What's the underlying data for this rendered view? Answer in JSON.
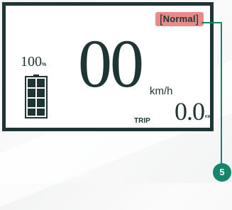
{
  "display": {
    "mode": "Normal",
    "mode_bracket_open": "[",
    "mode_bracket_close": "]",
    "battery_percent": "100",
    "battery_percent_unit": "%",
    "battery_level": 1.0,
    "speed": "00",
    "speed_unit": "km/h",
    "trip_label": "TRIP",
    "trip_value": "0.0",
    "trip_unit": "KM"
  },
  "callout": {
    "number": "5"
  },
  "colors": {
    "frame": "#1f3435",
    "mode_badge": "#e88a87",
    "callout": "#14866b"
  }
}
